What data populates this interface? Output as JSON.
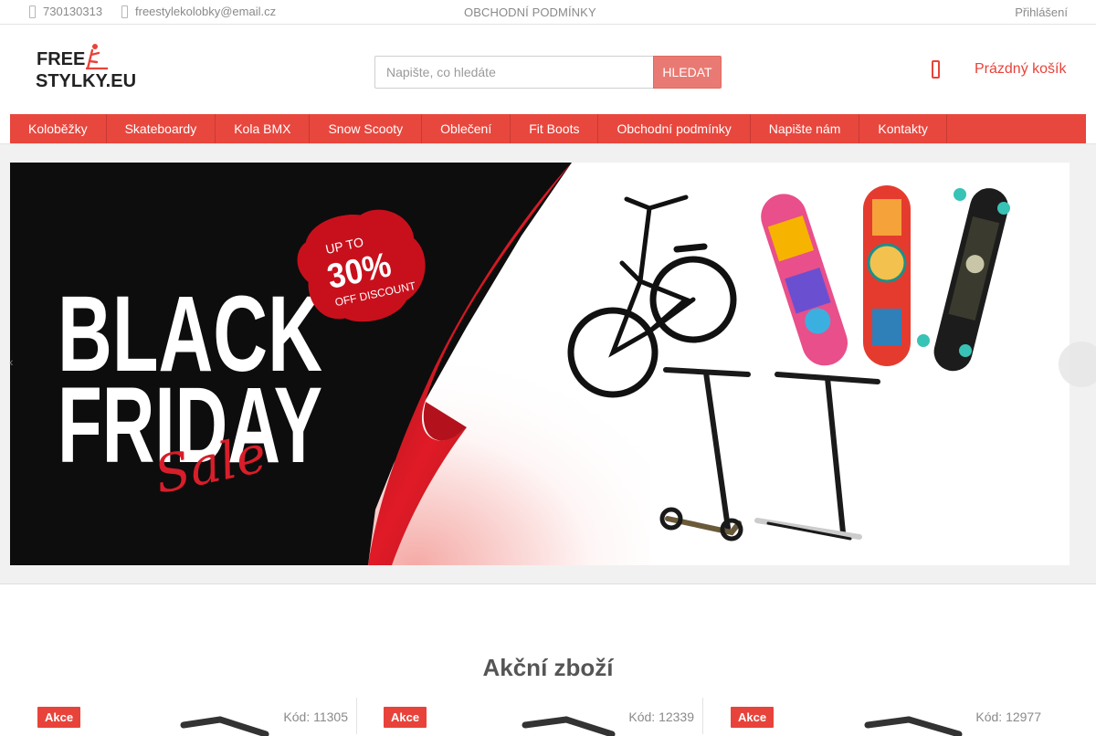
{
  "topbar": {
    "phone": "730130313",
    "email": "freestylekolobky@email.cz",
    "center_link": "OBCHODNÍ PODMÍNKY",
    "login": "Přihlášení"
  },
  "header": {
    "logo_line1": "FREE",
    "logo_line2": "STYLKY.EU",
    "search_placeholder": "Napište, co hledáte",
    "search_button": "HLEDAT",
    "cart_label": "Prázdný košík"
  },
  "nav": {
    "items": [
      {
        "label": "Koloběžky"
      },
      {
        "label": "Skateboardy"
      },
      {
        "label": "Kola BMX"
      },
      {
        "label": "Snow Scooty"
      },
      {
        "label": "Oblečení"
      },
      {
        "label": "Fit Boots"
      },
      {
        "label": "Obchodní podmínky"
      },
      {
        "label": "Napište nám"
      },
      {
        "label": "Kontakty"
      }
    ]
  },
  "banner": {
    "line1": "BLACK",
    "line2": "FRIDAY",
    "script": "Sale",
    "badge_top": "UP TO",
    "badge_pct": "30%",
    "badge_bottom": "OFF DISCOUNT"
  },
  "products_section": {
    "title": "Akční zboží",
    "items": [
      {
        "badge": "Akce",
        "code": "Kód: 11305"
      },
      {
        "badge": "Akce",
        "code": "Kód: 12339"
      },
      {
        "badge": "Akce",
        "code": "Kód: 12977"
      }
    ]
  },
  "colors": {
    "accent": "#e8473e",
    "search_button": "#e97a73",
    "cart": "#e8433a"
  }
}
